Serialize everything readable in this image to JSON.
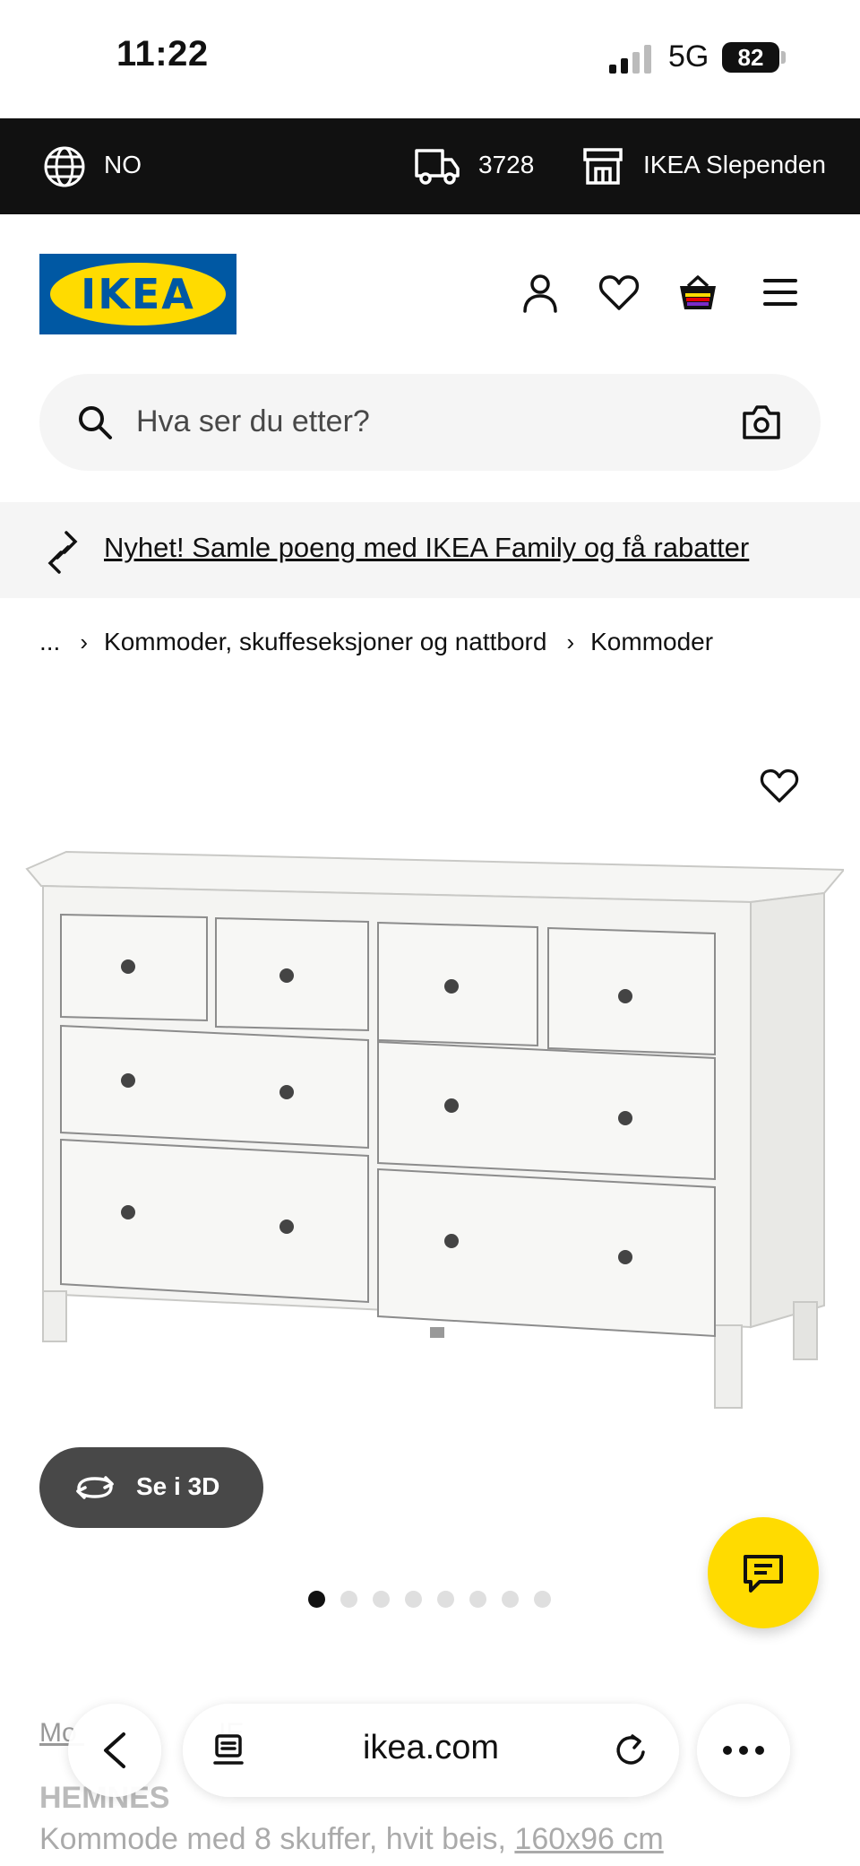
{
  "status_bar": {
    "time": "11:22",
    "network": "5G",
    "battery": "82"
  },
  "top_bar": {
    "language": "NO",
    "postal_code": "3728",
    "store": "IKEA Slependen"
  },
  "header": {
    "logo_text": "IKEA",
    "brand_blue": "#0058a3",
    "brand_yellow": "#ffdb00"
  },
  "search": {
    "placeholder": "Hva ser du etter?"
  },
  "promo": {
    "text": "Nyhet! Samle poeng med IKEA Family og få rabatter"
  },
  "breadcrumb": {
    "items": [
      "...",
      "Kommoder, skuffeseksjoner og nattbord",
      "Kommoder"
    ]
  },
  "gallery": {
    "button_3d": "Se i 3D",
    "image_count": 8,
    "active_image": 1
  },
  "product": {
    "breadcrumb_partial_1": "Mo",
    "breadcrumb_partial_2": "IE",
    "name": "HEMNES",
    "description": "Kommode med 8 skuffer, hvit beis, ",
    "size": "160x96 cm"
  },
  "browser": {
    "url": "ikea.com"
  }
}
